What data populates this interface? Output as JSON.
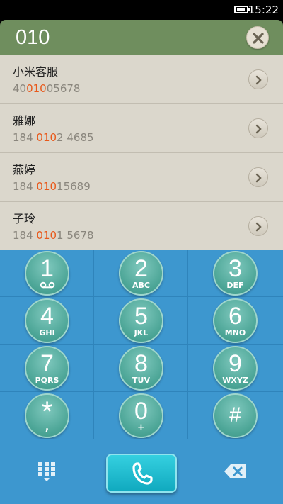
{
  "status_bar": {
    "time": "15:22"
  },
  "search": {
    "query": "010"
  },
  "results": [
    {
      "name": "小米客服",
      "number_before": "40",
      "number_match": "010",
      "number_after": "05678"
    },
    {
      "name": "雅娜",
      "number_before": "184 ",
      "number_match": "010",
      "number_after": "2 4685"
    },
    {
      "name": "燕婷",
      "number_before": "184 ",
      "number_match": "010",
      "number_after": "15689"
    },
    {
      "name": "子玲",
      "number_before": "184 ",
      "number_match": "010",
      "number_after": "1 5678"
    }
  ],
  "keypad": {
    "keys": [
      {
        "digit": "1",
        "sub": ""
      },
      {
        "digit": "2",
        "sub": "ABC"
      },
      {
        "digit": "3",
        "sub": "DEF"
      },
      {
        "digit": "4",
        "sub": "GHI"
      },
      {
        "digit": "5",
        "sub": "JKL"
      },
      {
        "digit": "6",
        "sub": "MNO"
      },
      {
        "digit": "7",
        "sub": "PQRS"
      },
      {
        "digit": "8",
        "sub": "TUV"
      },
      {
        "digit": "9",
        "sub": "WXYZ"
      },
      {
        "digit": "*",
        "sub": ","
      },
      {
        "digit": "0",
        "sub": "+"
      },
      {
        "digit": "#",
        "sub": ""
      }
    ]
  },
  "icons": {
    "battery": "battery-icon",
    "clear": "clear-icon",
    "detail": "chevron-right-icon",
    "voicemail": "voicemail-icon",
    "dialpad": "dialpad-icon",
    "call": "phone-icon",
    "backspace": "backspace-icon"
  },
  "colors": {
    "header": "#6f8e5e",
    "list_background": "#dbd7cc",
    "match_highlight": "#e8581a",
    "keypad_background": "#3d97cf",
    "key_fill": "#4aa495",
    "call_button": "#10a9bf"
  }
}
